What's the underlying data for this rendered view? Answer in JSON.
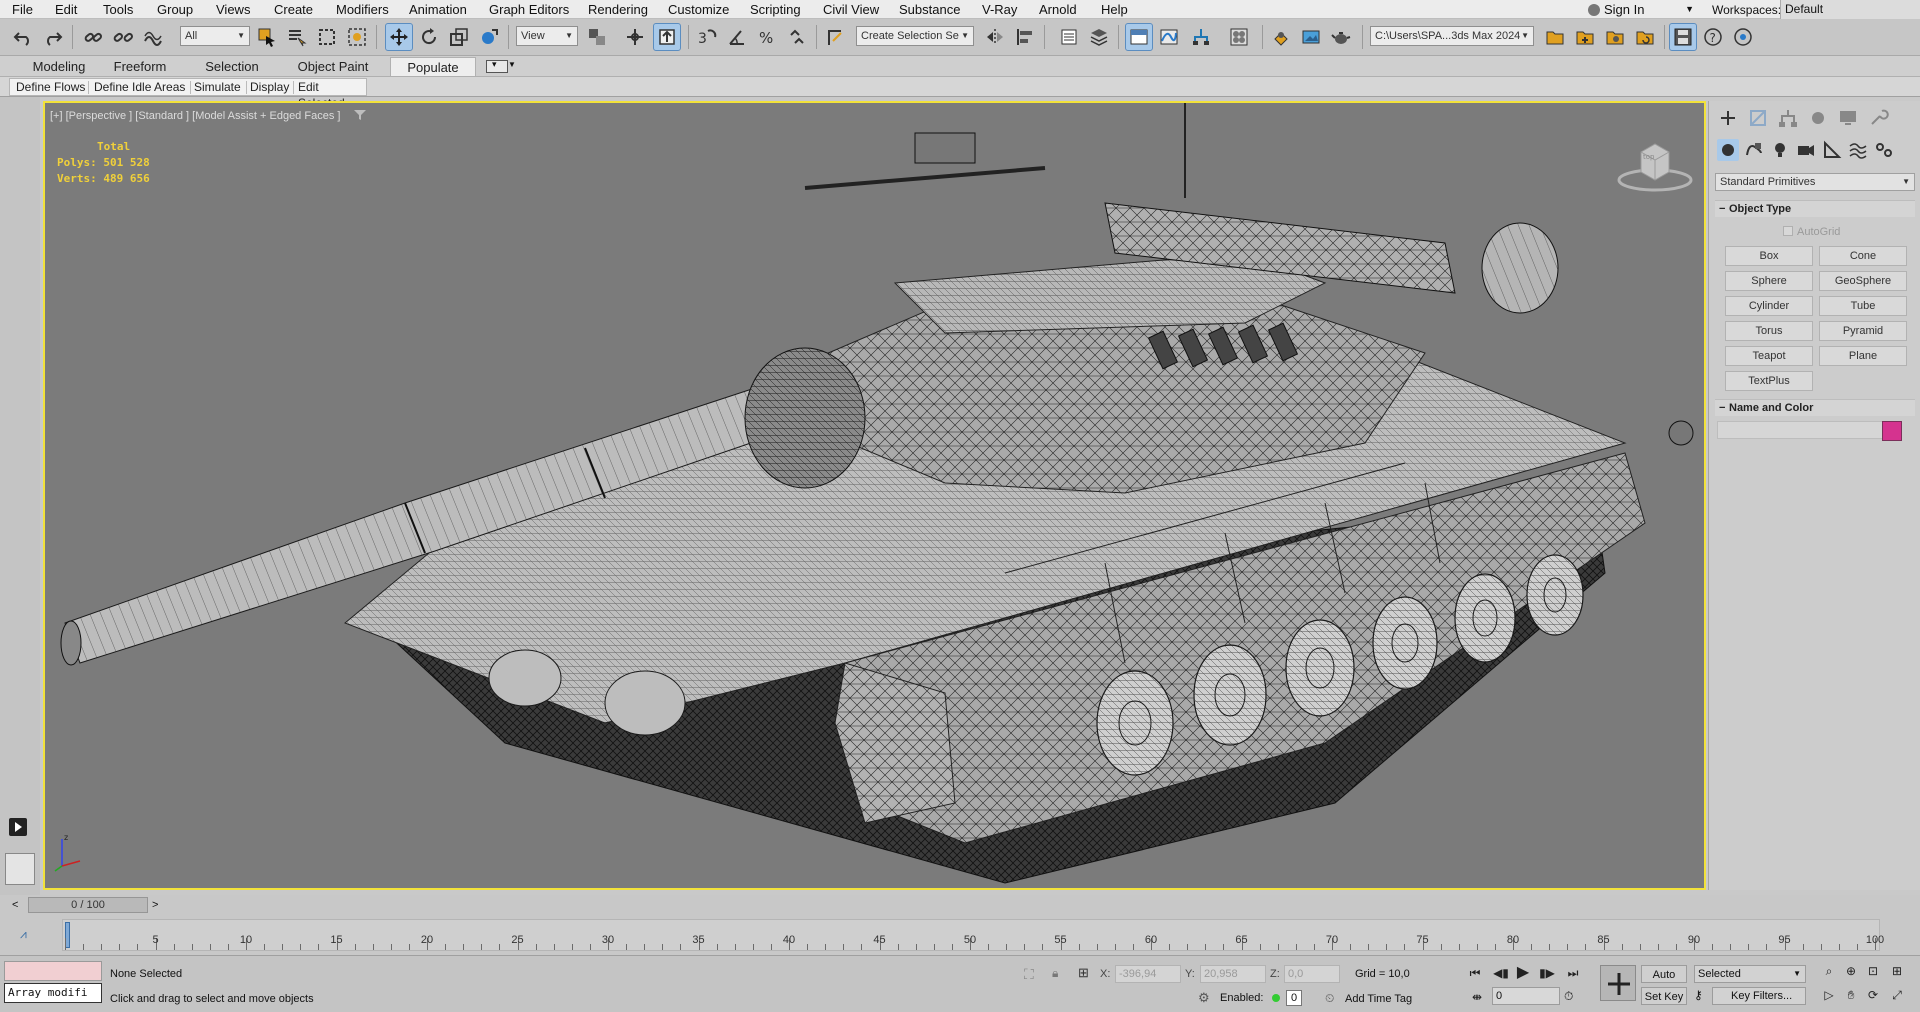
{
  "menubar": {
    "items": [
      "File",
      "Edit",
      "Tools",
      "Group",
      "Views",
      "Create",
      "Modifiers",
      "Animation",
      "Graph Editors",
      "Rendering",
      "Customize",
      "Scripting",
      "Civil View",
      "Substance",
      "V-Ray",
      "Arnold",
      "Help"
    ],
    "sign_in": "Sign In",
    "workspaces_label": "Workspaces:",
    "workspace_value": "Default"
  },
  "toolbar": {
    "selection_filter": "All",
    "ref_coord": "View",
    "named_selection": "Create Selection Se",
    "project_path": "C:\\Users\\SPA...3ds Max 2024"
  },
  "ribbon": {
    "tabs": [
      "Modeling",
      "Freeform",
      "Selection",
      "Object Paint",
      "Populate"
    ],
    "active_tab": "Populate",
    "sub_items": [
      "Define Flows",
      "Define Idle Areas",
      "Simulate",
      "Display",
      "Edit Selected"
    ]
  },
  "viewport": {
    "label": "[+] [Perspective ] [Standard ] [Model Assist + Edged Faces ]",
    "stats": {
      "title": "Total",
      "polys_label": "Polys:",
      "polys": "501 528",
      "verts_label": "Verts:",
      "verts": "489 656"
    },
    "viewcube_label": "top",
    "border_color": "#f2e23a",
    "background_color": "#7b7b7b"
  },
  "command_panel": {
    "primitive_category": "Standard Primitives",
    "object_type_title": "Object Type",
    "autogrid": "AutoGrid",
    "buttons": [
      "Box",
      "Cone",
      "Sphere",
      "GeoSphere",
      "Cylinder",
      "Tube",
      "Torus",
      "Pyramid",
      "Teapot",
      "Plane",
      "TextPlus"
    ],
    "name_color_title": "Name and Color",
    "object_color": "#d5338f"
  },
  "timeline": {
    "slider_value": "0 / 100",
    "prev": "<",
    "next": ">",
    "tick_labels": [
      "0",
      "5",
      "10",
      "15",
      "20",
      "25",
      "30",
      "35",
      "40",
      "45",
      "50",
      "55",
      "60",
      "65",
      "70",
      "75",
      "80",
      "85",
      "90",
      "95",
      "100"
    ]
  },
  "status": {
    "maxscript_text": "Array modifi",
    "selection": "None Selected",
    "prompt": "Click and drag to select and move objects",
    "x_label": "X:",
    "x_value": "-396,94",
    "y_label": "Y:",
    "y_value": "20,958",
    "z_label": "Z:",
    "z_value": "0,0",
    "grid": "Grid = 10,0",
    "enabled_label": "Enabled:",
    "enabled_value": "0",
    "add_time_tag": "Add Time Tag",
    "auto_key": "Auto Key",
    "set_key": "Set Key",
    "key_mode": "Selected",
    "key_filters": "Key Filters...",
    "current_frame": "0"
  }
}
